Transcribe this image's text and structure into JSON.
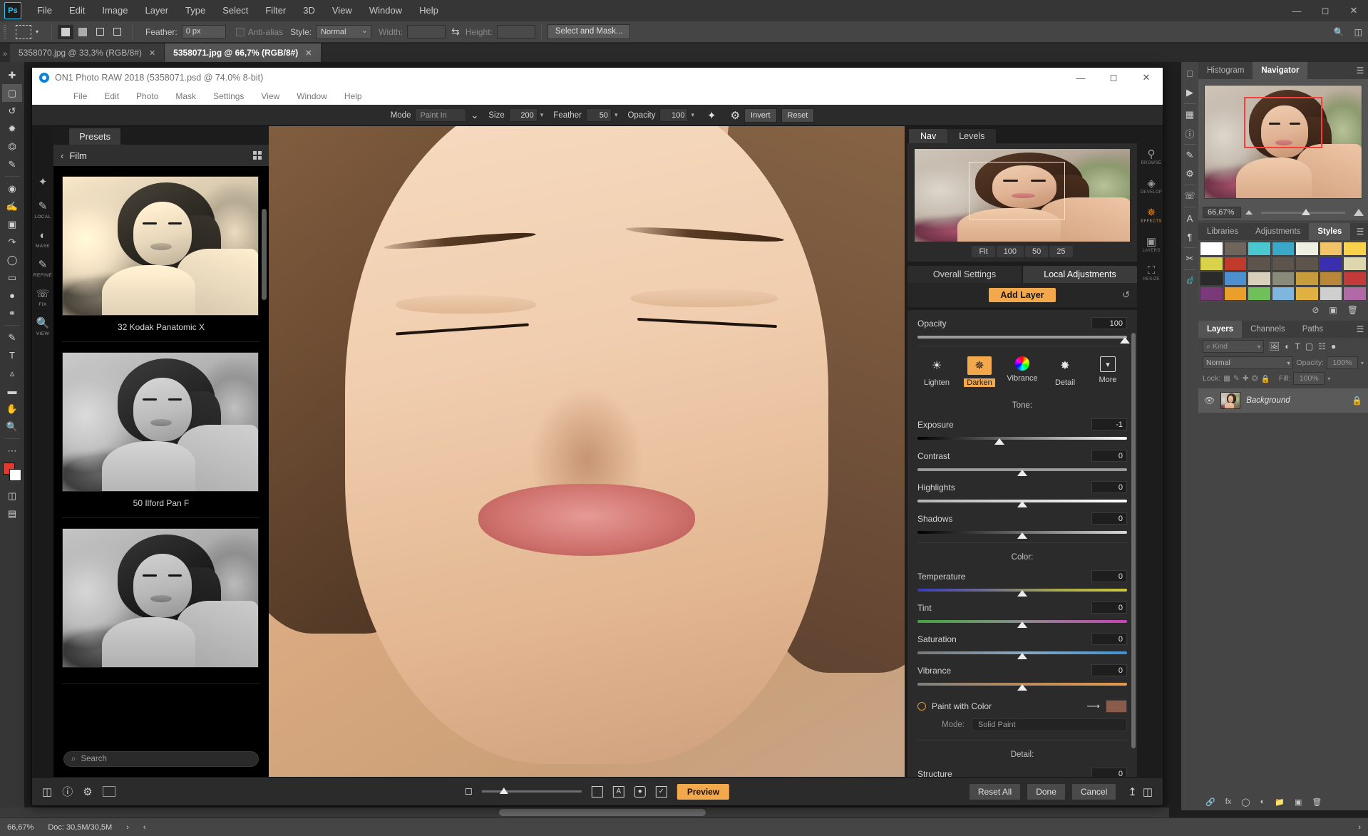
{
  "photoshop": {
    "app_logo": "Ps",
    "menu": [
      "File",
      "Edit",
      "Image",
      "Layer",
      "Type",
      "Select",
      "Filter",
      "3D",
      "View",
      "Window",
      "Help"
    ],
    "window_buttons": [
      "minimize",
      "maximize",
      "close"
    ],
    "options_bar": {
      "tool_icon": "rectangular-marquee-icon",
      "selection_modes": [
        "new-selection",
        "add-to-selection",
        "subtract-from-selection",
        "intersect-with-selection"
      ],
      "feather_label": "Feather:",
      "feather_value": "0 px",
      "antialias_label": "Anti-alias",
      "style_label": "Style:",
      "style_value": "Normal",
      "width_label": "Width:",
      "width_value": "",
      "swap_icon": "swap-arrows-icon",
      "height_label": "Height:",
      "height_value": "",
      "select_and_mask_label": "Select and Mask..."
    },
    "document_tabs": [
      {
        "label": "5358070.jpg @ 33,3% (RGB/8#)",
        "active": false
      },
      {
        "label": "5358071.jpg @ 66,7% (RGB/8#)",
        "active": true
      }
    ],
    "status_bar": {
      "zoom": "66,67%",
      "doc_info": "Doc: 30,5M/30,5M"
    },
    "panels": {
      "top_group": {
        "tabs": [
          "Histogram",
          "Navigator"
        ],
        "active_tab": "Navigator",
        "zoom_value": "66,67%"
      },
      "styles_group": {
        "tabs": [
          "Libraries",
          "Adjustments",
          "Styles"
        ],
        "active_tab": "Styles",
        "footer_icons": [
          "clear-style-icon",
          "new-style-icon",
          "delete-style-icon"
        ],
        "swatch_colors": [
          "#ffffff",
          "#6f655c",
          "#49c8cf",
          "#3aa8c6",
          "#eef0e2",
          "#f2c46a",
          "#f8d24a",
          "#d9d24a",
          "#c23a2a",
          "#5d554c",
          "#5d554c",
          "#5d554c",
          "#3a2fb0",
          "#ddd7b0",
          "#2a2a2a",
          "#4e8fd0",
          "#d9d0bc",
          "#8a8a7a",
          "#c79c3c",
          "#b8873a",
          "#c43a3a",
          "#7a3a7a",
          "#e8a02a",
          "#6fbf5a",
          "#7fb6dd",
          "#e0b040",
          "#cfcfcf",
          "#b06aa8"
        ]
      },
      "layers_group": {
        "tabs": [
          "Layers",
          "Channels",
          "Paths"
        ],
        "active_tab": "Layers",
        "filter_label": "Kind",
        "filter_icons": [
          "pixel-filter-icon",
          "adjustment-filter-icon",
          "type-filter-icon",
          "shape-filter-icon",
          "smart-object-filter-icon"
        ],
        "blend_mode": "Normal",
        "opacity_label": "Opacity:",
        "opacity_value": "100%",
        "lock_label": "Lock:",
        "lock_icons": [
          "lock-transparency-icon",
          "lock-image-icon",
          "lock-position-icon",
          "lock-artboard-icon",
          "lock-all-icon"
        ],
        "fill_label": "Fill:",
        "fill_value": "100%",
        "layers": [
          {
            "name": "Background",
            "visible": true,
            "locked": true
          }
        ],
        "footer_icons": [
          "link-icon",
          "fx-icon",
          "mask-icon",
          "adjustment-icon",
          "group-icon",
          "new-layer-icon",
          "trash-icon"
        ]
      }
    },
    "toolbox": [
      "move-tool",
      "marquee-tool",
      "lasso-tool",
      "quick-selection-tool",
      "crop-tool",
      "eyedropper-tool",
      "spot-healing-tool",
      "brush-tool",
      "clone-stamp-tool",
      "history-brush-tool",
      "eraser-tool",
      "gradient-tool",
      "blur-tool",
      "dodge-tool",
      "pen-tool",
      "type-tool",
      "path-selection-tool",
      "shape-tool",
      "hand-tool",
      "zoom-tool",
      "edit-toolbar-tool"
    ]
  },
  "on1": {
    "title": "ON1 Photo RAW 2018 (5358071.psd @ 74.0% 8-bit)",
    "title_icon": "on1-logo-icon",
    "window_buttons": [
      "minimize",
      "maximize",
      "close"
    ],
    "menu": [
      "File",
      "Edit",
      "Photo",
      "Mask",
      "Settings",
      "View",
      "Window",
      "Help"
    ],
    "toolbar": {
      "mode_label": "Mode",
      "mode_value": "Paint In",
      "size_label": "Size",
      "size_value": "200",
      "feather_label": "Feather",
      "feather_value": "50",
      "opacity_label": "Opacity",
      "opacity_value": "100",
      "wand_icon": "perfect-brush-icon",
      "gear_icon": "gear-icon",
      "invert_label": "Invert",
      "reset_label": "Reset"
    },
    "left_rail": [
      {
        "icon": "magic-wand-icon",
        "label": ""
      },
      {
        "icon": "local-icon",
        "label": "LOCAL"
      },
      {
        "icon": "mask-icon",
        "label": "MASK"
      },
      {
        "icon": "refine-icon",
        "label": "REFINE"
      },
      {
        "icon": "fix-icon",
        "label": "FIX"
      },
      {
        "icon": "view-icon",
        "label": "VIEW"
      }
    ],
    "presets": {
      "tab_label": "Presets",
      "back_icon": "chevron-left-icon",
      "category": "Film",
      "grid_icon": "grid-view-icon",
      "items": [
        {
          "name": "32 Kodak Panatomic X"
        },
        {
          "name": "50 Ilford Pan F"
        },
        {
          "name": ""
        }
      ],
      "search_placeholder": "Search",
      "search_icon": "search-icon"
    },
    "right_panel": {
      "nav_tabs": [
        "Nav",
        "Levels"
      ],
      "nav_active": "Nav",
      "zoom_buttons": [
        "Fit",
        "100",
        "50",
        "25"
      ],
      "settings_tabs": [
        "Overall Settings",
        "Local Adjustments"
      ],
      "settings_active": "Local Adjustments",
      "add_layer_label": "Add Layer",
      "reset_icon": "reset-arrow-icon",
      "opacity_label": "Opacity",
      "opacity_value": "100",
      "modules": [
        {
          "label": "Lighten",
          "icon": "sun-icon",
          "active": false
        },
        {
          "label": "Darken",
          "icon": "dark-sun-icon",
          "active": true
        },
        {
          "label": "Vibrance",
          "icon": "color-wheel-icon",
          "active": false
        },
        {
          "label": "Detail",
          "icon": "sparkle-icon",
          "active": false
        },
        {
          "label": "More",
          "icon": "chevron-box-icon",
          "active": false
        }
      ],
      "tone_section": "Tone:",
      "tone_sliders": [
        {
          "label": "Exposure",
          "value": "-1",
          "pos": 33
        },
        {
          "label": "Contrast",
          "value": "0",
          "pos": 50
        },
        {
          "label": "Highlights",
          "value": "0",
          "pos": 50
        },
        {
          "label": "Shadows",
          "value": "0",
          "pos": 50
        }
      ],
      "color_section": "Color:",
      "color_sliders": [
        {
          "label": "Temperature",
          "value": "0",
          "pos": 50
        },
        {
          "label": "Tint",
          "value": "0",
          "pos": 50
        },
        {
          "label": "Saturation",
          "value": "0",
          "pos": 50
        },
        {
          "label": "Vibrance",
          "value": "0",
          "pos": 50
        }
      ],
      "paint_with_color_label": "Paint with Color",
      "eyedropper_icon": "eyedropper-icon",
      "paint_color": "#8a5a4a",
      "mode_label": "Mode:",
      "mode_value": "Solid Paint",
      "detail_section": "Detail:",
      "detail_sliders": [
        {
          "label": "Structure",
          "value": "0",
          "pos": 50
        }
      ]
    },
    "right_rail": [
      {
        "icon": "browse-icon",
        "label": "BROWSE",
        "active": false
      },
      {
        "icon": "develop-icon",
        "label": "DEVELOP",
        "active": false
      },
      {
        "icon": "effects-icon",
        "label": "EFFECTS",
        "active": true
      },
      {
        "icon": "layers-icon",
        "label": "LAYERS",
        "active": false
      },
      {
        "icon": "resize-icon",
        "label": "RESIZE",
        "active": false
      }
    ],
    "bottom_bar": {
      "left_icons": [
        "panels-toggle-icon",
        "help-icon",
        "gear-icon",
        "compare-icon"
      ],
      "center_icons": [
        "small-thumb-icon",
        "thumb-size-slider",
        "fit-icon",
        "text-icon",
        "mask-view-icon",
        "checkmark-icon"
      ],
      "preview_label": "Preview",
      "buttons": [
        "Reset All",
        "Done",
        "Cancel"
      ],
      "right_icons": [
        "share-icon",
        "split-view-icon"
      ]
    }
  }
}
